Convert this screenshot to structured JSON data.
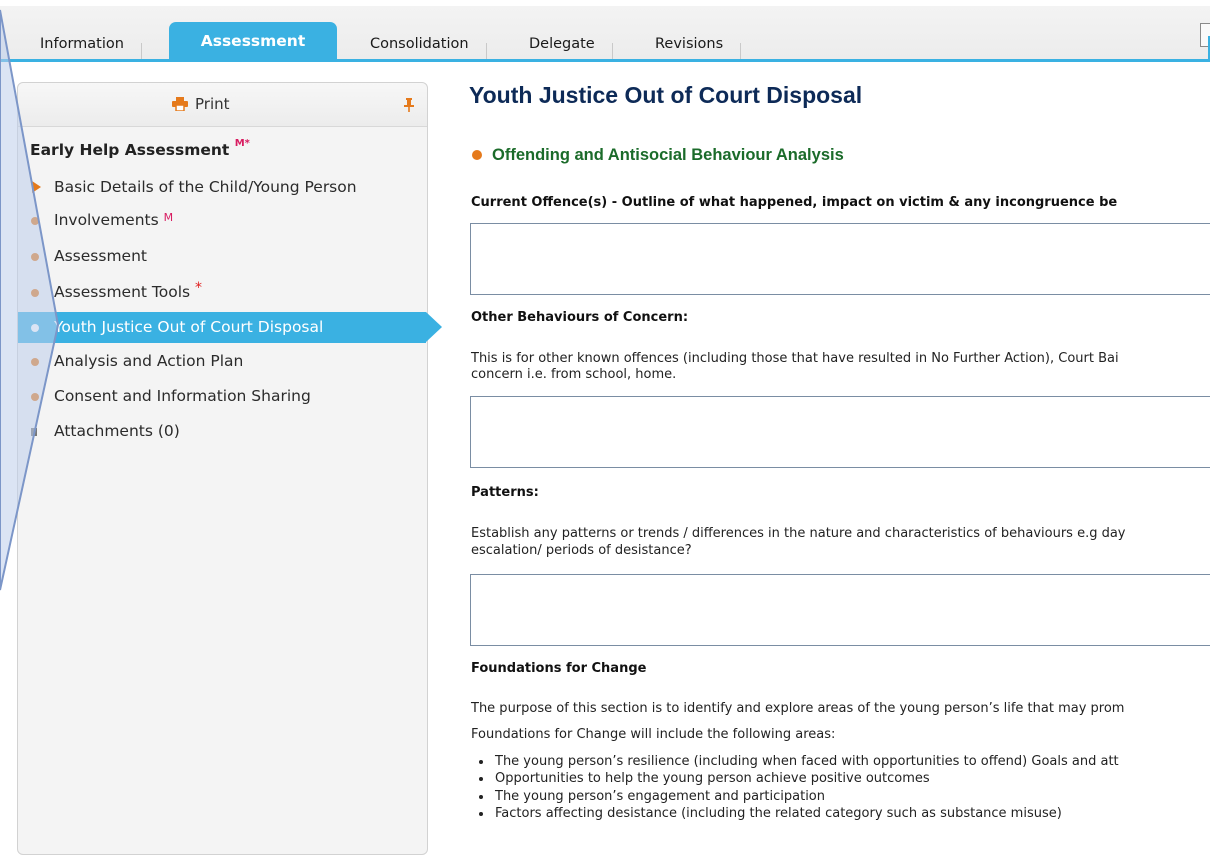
{
  "tabs": [
    {
      "label": "Information"
    },
    {
      "label": "Assessment"
    },
    {
      "label": "Consolidation"
    },
    {
      "label": "Delegate"
    },
    {
      "label": "Revisions"
    }
  ],
  "sidebar": {
    "print_label": "Print",
    "title": "Early Help Assessment",
    "title_marks": "M*",
    "items": [
      {
        "label": "Basic Details of the Child/Young Person"
      },
      {
        "label": "Involvements",
        "mark": "M"
      },
      {
        "label": "Assessment"
      },
      {
        "label": "Assessment Tools",
        "mark": "*"
      },
      {
        "label": "Youth Justice Out of Court Disposal"
      },
      {
        "label": "Analysis and Action Plan"
      },
      {
        "label": "Consent and Information Sharing"
      },
      {
        "label": "Attachments (0)"
      }
    ]
  },
  "main": {
    "title": "Youth Justice Out of Court Disposal",
    "section": "Offending and Antisocial Behaviour Analysis",
    "q1_label": "Current Offence(s) - Outline of what happened, impact on victim & any incongruence be",
    "q2_label": "Other Behaviours of Concern:",
    "q2_desc_line1": "This is for other known offences (including those that have resulted in No Further Action), Court Bai",
    "q2_desc_line2": "concern i.e. from school, home.",
    "q3_label": "Patterns:",
    "q3_desc_line1": "Establish any patterns or trends / differences in the nature and characteristics of behaviours e.g day",
    "q3_desc_line2": "escalation/ periods of desistance?",
    "q4_label": "Foundations for Change",
    "q4_desc1": "The purpose of this section is to identify and explore areas of the young person’s life that may prom",
    "q4_desc2": "Foundations for Change will include the following areas:",
    "bullets": [
      "The young person’s resilience (including when faced with opportunities to offend) Goals and att",
      "Opportunities to help the young person achieve positive outcomes",
      "The young person’s engagement and participation",
      "Factors affecting desistance (including the related category such as substance misuse)"
    ]
  },
  "colors": {
    "accent": "#3ab1e2",
    "bullet": "#e57a1c",
    "title": "#0d2a57",
    "section": "#1b6b2a",
    "required": "#d81b60"
  }
}
